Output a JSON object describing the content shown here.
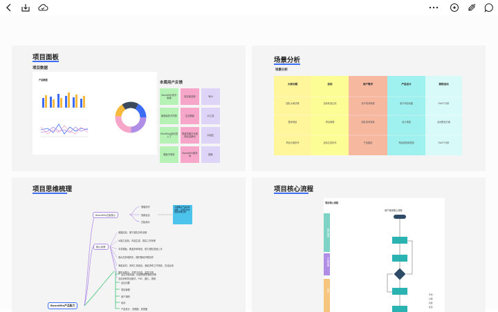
{
  "toolbar": {
    "left_icons": [
      "back-icon",
      "download-icon",
      "cloud-icon"
    ],
    "right_icons": [
      "more-icon",
      "play-icon",
      "magic-brush-icon",
      "comment-icon"
    ]
  },
  "cards": {
    "dashboard": {
      "title": "项目面板",
      "data_heading": "项目数据",
      "chart_title": "产品数据",
      "feedback_heading": "本周用户反馈",
      "stickies": [
        {
          "text": "BoardMix的平板端",
          "color": "#b6f1b6"
        },
        {
          "text": "是否能选择",
          "color": "#f6a7c9"
        },
        {
          "text": "有AI",
          "color": "#ddd4f7"
        },
        {
          "text": "能够高阶不同的",
          "color": "#b6f1b6"
        },
        {
          "text": "交互看起",
          "color": "#f6a7c9"
        },
        {
          "text": "AI工具",
          "color": "#ddd4f7"
        },
        {
          "text": "MindMap如何进入了",
          "color": "#b6f1b6"
        },
        {
          "text": "思维导图不可拖拽自由移动",
          "color": "#f6a7c9"
        },
        {
          "text": "对话生",
          "color": "#ddd4f7"
        },
        {
          "text": "模板不够多",
          "color": "#b6f1b6"
        },
        {
          "text": "BoardMix更多场",
          "color": "#f6a7c9"
        },
        {
          "text": "图库",
          "color": "#ddd4f7"
        }
      ]
    },
    "scene": {
      "title": "场景分析",
      "subtitle": "场景分析",
      "columns": [
        {
          "head": "大局问题",
          "color": "#fff59a",
          "cells": [
            "团队大局决策",
            "整体规划",
            "项目大局协作"
          ]
        },
        {
          "head": "目标",
          "color": "#fdfd96",
          "cells": [
            "目标精准达成",
            "项目管理",
            "目标达成协作"
          ]
        },
        {
          "head": "用户需求",
          "color": "#f7b8a0",
          "cells": [
            "用户需求管理",
            "团队需求收集",
            "产品路线"
          ]
        },
        {
          "head": "产品设计",
          "color": "#9ff1ef",
          "cells": [
            "用户体验地图",
            "设计草图",
            "界面线框原型图"
          ]
        },
        {
          "head": "营销活动",
          "color": "#d8faf8",
          "cells": [
            "SWOT分析",
            "活动策划方案",
            "SWOT分析"
          ]
        }
      ]
    },
    "mindmap": {
      "title": "项目思维梳理",
      "root": "BoardMix产品能力",
      "branch_top": "BoardMix白板核心",
      "branch_top_children": [
        "便捷协作",
        "视频会议",
        "白板演示"
      ],
      "note": "全面覆盖产品使用流程，让团队协作更加流畅高效",
      "branch_mid": "核心优势",
      "branch_mid_children": [
        "便捷高效，便于团队协作创新",
        "AI能力加持，内容生成，提高工作效率",
        "丰富模板，覆盖多种场景，助力团队快速上手",
        "强大的多端同步，随时随地开展协作",
        "海量素材，多种工具组合，满足多种工作场景，灵活运用",
        "图形化展示，不限于内容，激发灵感",
        "支持多种导出格式，PDF，图片，视频"
      ],
      "branch_low_children": [
        "会议头脑风暴，快速梳理思路和决策",
        "会议纪要",
        "项目管理",
        "用户调研",
        "培训",
        "产品设计：流程图、原型图"
      ]
    },
    "flow": {
      "title": "项目核心流程",
      "lane_title": "项目核心流程",
      "flow_title": "用户使用核心流程",
      "lanes": [
        {
          "label": "用户需求",
          "color": "#7dd3c6"
        },
        {
          "label": "产品功能",
          "color": "#b08ee6"
        },
        {
          "label": "设计",
          "color": "#f7c67e"
        }
      ],
      "legend": [
        "开始",
        "过程",
        "判断",
        "结束"
      ]
    }
  }
}
